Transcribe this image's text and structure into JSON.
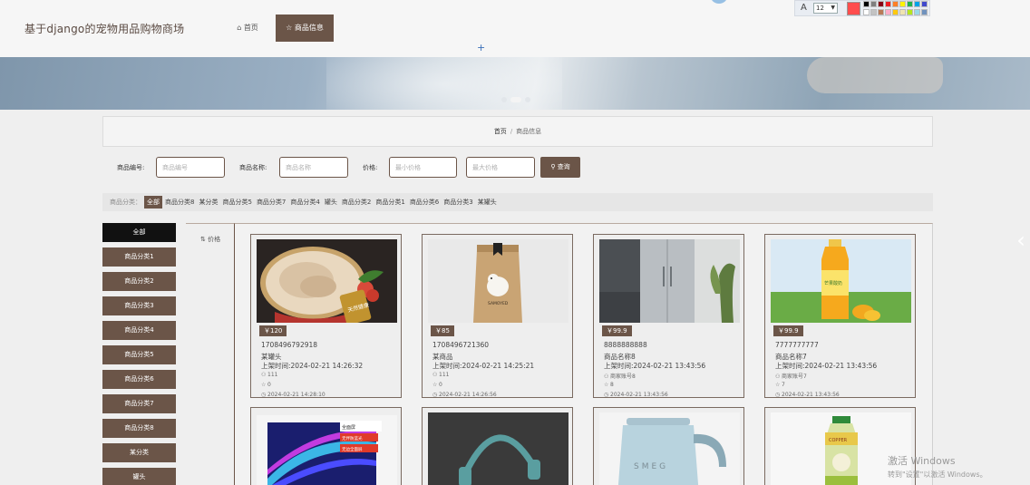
{
  "header": {
    "site_title": "基于django的宠物用品购物商场",
    "nav": [
      {
        "label": "首页",
        "icon": "home-icon"
      },
      {
        "label": "商品信息",
        "icon": "star-icon",
        "active": true
      }
    ]
  },
  "paint_toolbar": {
    "font_glyph": "A",
    "font_size": "12",
    "active_color": "#ff4d4d",
    "palette": [
      "#000000",
      "#7f7f7f",
      "#880015",
      "#ed1c24",
      "#ff7f27",
      "#fff200",
      "#22b14c",
      "#00a2e8",
      "#3f48cc",
      "#ffffff",
      "#c3c3c3",
      "#b97a57",
      "#ffaec9",
      "#ffc90e",
      "#efe4b0",
      "#b5e61d",
      "#99d9ea",
      "#7092be"
    ]
  },
  "banner": {
    "slides": 3,
    "active_slide": 1
  },
  "breadcrumb": {
    "home": "首页",
    "separator": "/",
    "current": "商品信息"
  },
  "search": {
    "code_label": "商品编号:",
    "code_placeholder": "商品编号",
    "name_label": "商品名称:",
    "name_placeholder": "商品名称",
    "price_label": "价格:",
    "min_placeholder": "最小价格",
    "max_placeholder": "最大价格",
    "button_label": "查询"
  },
  "category_bar": {
    "label": "商品分类：",
    "items": [
      "全部",
      "商品分类8",
      "某分类",
      "商品分类5",
      "商品分类7",
      "商品分类4",
      "罐头",
      "商品分类2",
      "商品分类1",
      "商品分类6",
      "商品分类3",
      "某罐头"
    ]
  },
  "sidebar": {
    "items": [
      "全部",
      "商品分类1",
      "商品分类2",
      "商品分类3",
      "商品分类4",
      "商品分类5",
      "商品分类6",
      "商品分类7",
      "商品分类8",
      "某分类",
      "罐头"
    ]
  },
  "sort": {
    "label": "价格"
  },
  "products": [
    {
      "price": "￥120",
      "code": "1708496792918",
      "name": "某罐头",
      "listed": "上架时间:2024-02-21 14:26:32",
      "merchant": "111",
      "likes": "0",
      "updated": "2024-02-21 14:28:10"
    },
    {
      "price": "￥85",
      "code": "1708496721360",
      "name": "某商品",
      "listed": "上架时间:2024-02-21 14:25:21",
      "merchant": "111",
      "likes": "0",
      "updated": "2024-02-21 14:26:56"
    },
    {
      "price": "￥99.9",
      "code": "8888888888",
      "name": "商品名称8",
      "listed": "上架时间:2024-02-21 13:43:56",
      "merchant": "商家账号8",
      "likes": "8",
      "updated": "2024-02-21 13:43:56"
    },
    {
      "price": "￥99.9",
      "code": "7777777777",
      "name": "商品名称7",
      "listed": "上架时间:2024-02-21 13:43:56",
      "merchant": "商家账号7",
      "likes": "7",
      "updated": "2024-02-21 13:43:56"
    }
  ],
  "product_image_texts": {
    "can_label": "天然健康",
    "bag_brand": "SAMOYED",
    "juice_label": "芒果酸奶",
    "laptop_tags": [
      "全面屏",
      "无伴防蓝光",
      "无边全面屏"
    ],
    "kettle_brand": "SMEG",
    "bottle_brand": "COPPER"
  },
  "watermark": {
    "line1": "激活 Windows",
    "line2": "转到\"设置\"以激活 Windows。"
  }
}
